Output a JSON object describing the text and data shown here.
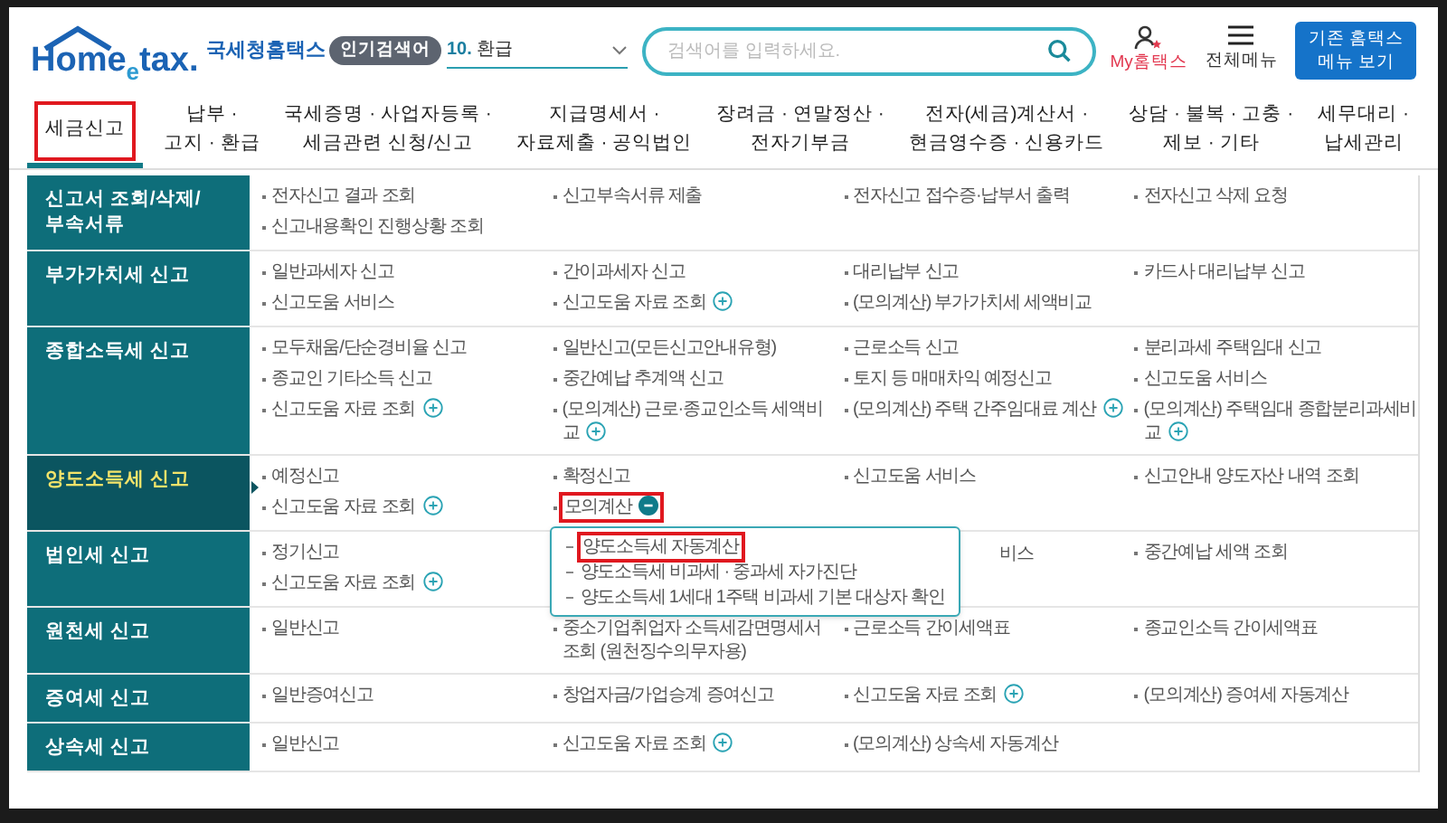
{
  "header": {
    "logo_text": "Home",
    "logo_e": "e",
    "logo_tax": "tax.",
    "site_name": "국세청홈택스",
    "popular_badge": "인기검색어",
    "popular_rank": "10.",
    "popular_term": "환급",
    "search": {
      "placeholder": "검색어를 입력하세요."
    },
    "my_link": "My홈택스",
    "menu_label": "전체메뉴",
    "legacy_button": "기존 홈택스\n메뉴 보기"
  },
  "nav": [
    {
      "label": "세금신고",
      "selected": true,
      "highlighted": true
    },
    {
      "label": "납부 ·\n고지 · 환급",
      "selected": false,
      "highlighted": false
    },
    {
      "label": "국세증명 · 사업자등록 ·\n세금관련 신청/신고",
      "selected": false,
      "highlighted": false
    },
    {
      "label": "지급명세서 ·\n자료제출 · 공익법인",
      "selected": false,
      "highlighted": false
    },
    {
      "label": "장려금 · 연말정산 ·\n전자기부금",
      "selected": false,
      "highlighted": false
    },
    {
      "label": "전자(세금)계산서 ·\n현금영수증 · 신용카드",
      "selected": false,
      "highlighted": false
    },
    {
      "label": "상담 · 불복 · 고충 ·\n제보 · 기타",
      "selected": false,
      "highlighted": false
    },
    {
      "label": "세무대리 ·\n납세관리",
      "selected": false,
      "highlighted": false
    }
  ],
  "sections": [
    {
      "title": "신고서 조회/삭제/\n부속서류",
      "selected": false,
      "columns": [
        [
          {
            "text": "전자신고 결과 조회"
          },
          {
            "text": "신고내용확인 진행상황 조회"
          }
        ],
        [
          {
            "text": "신고부속서류 제출"
          }
        ],
        [
          {
            "text": "전자신고 접수증·납부서 출력"
          }
        ],
        [
          {
            "text": "전자신고 삭제 요청"
          }
        ]
      ]
    },
    {
      "title": "부가가치세 신고",
      "selected": false,
      "columns": [
        [
          {
            "text": "일반과세자 신고"
          },
          {
            "text": "신고도움 서비스"
          }
        ],
        [
          {
            "text": "간이과세자 신고"
          },
          {
            "text": "신고도움 자료 조회",
            "expandable": true,
            "expanded": false
          }
        ],
        [
          {
            "text": "대리납부 신고"
          },
          {
            "text": "(모의계산) 부가가치세 세액비교"
          }
        ],
        [
          {
            "text": "카드사 대리납부 신고"
          }
        ]
      ]
    },
    {
      "title": "종합소득세 신고",
      "selected": false,
      "columns": [
        [
          {
            "text": "모두채움/단순경비율 신고"
          },
          {
            "text": "종교인 기타소득 신고"
          },
          {
            "text": "신고도움 자료 조회",
            "expandable": true,
            "expanded": false
          }
        ],
        [
          {
            "text": "일반신고(모든신고안내유형)"
          },
          {
            "text": "중간예납 추계액 신고"
          },
          {
            "text": "(모의계산) 근로·종교인소득 세액비교",
            "expandable": true,
            "expanded": false
          }
        ],
        [
          {
            "text": "근로소득 신고"
          },
          {
            "text": "토지 등 매매차익 예정신고"
          },
          {
            "text": "(모의계산) 주택 간주임대료 계산",
            "expandable": true,
            "expanded": false
          }
        ],
        [
          {
            "text": "분리과세 주택임대 신고"
          },
          {
            "text": "신고도움 서비스"
          },
          {
            "text": "(모의계산) 주택임대 종합분리과세비교",
            "expandable": true,
            "expanded": false
          }
        ]
      ]
    },
    {
      "title": "양도소득세 신고",
      "selected": true,
      "columns": [
        [
          {
            "text": "예정신고"
          },
          {
            "text": "신고도움 자료 조회",
            "expandable": true,
            "expanded": false
          }
        ],
        [
          {
            "text": "확정신고"
          },
          {
            "text": "모의계산",
            "expandable": true,
            "expanded": true,
            "highlighted": true,
            "submenu": [
              {
                "text": "양도소득세 자동계산",
                "highlighted": true
              },
              {
                "text": "양도소득세 비과세 · 중과세 자가진단",
                "highlighted": false
              },
              {
                "text": "양도소득세 1세대 1주택 비과세 기본 대상자 확인",
                "highlighted": false
              }
            ]
          }
        ],
        [
          {
            "text": "신고도움 서비스"
          }
        ],
        [
          {
            "text": "신고안내 양도자산 내역 조회"
          }
        ]
      ]
    },
    {
      "title": "법인세 신고",
      "selected": false,
      "columns": [
        [
          {
            "text": "정기신고"
          },
          {
            "text": "신고도움 자료 조회",
            "expandable": true,
            "expanded": false
          }
        ],
        [],
        [
          {
            "text": "비스",
            "clipped": true
          }
        ],
        [
          {
            "text": "중간예납 세액 조회"
          }
        ]
      ]
    },
    {
      "title": "원천세 신고",
      "selected": false,
      "columns": [
        [
          {
            "text": "일반신고"
          }
        ],
        [
          {
            "text": "중소기업취업자 소득세감면명세서 조회 (원천징수의무자용)"
          }
        ],
        [
          {
            "text": "근로소득 간이세액표"
          }
        ],
        [
          {
            "text": "종교인소득 간이세액표"
          }
        ]
      ]
    },
    {
      "title": "증여세 신고",
      "selected": false,
      "columns": [
        [
          {
            "text": "일반증여신고"
          }
        ],
        [
          {
            "text": "창업자금/가업승계 증여신고"
          }
        ],
        [
          {
            "text": "신고도움 자료 조회",
            "expandable": true,
            "expanded": false
          }
        ],
        [
          {
            "text": "(모의계산) 증여세 자동계산"
          }
        ]
      ]
    },
    {
      "title": "상속세 신고",
      "selected": false,
      "columns": [
        [
          {
            "text": "일반신고"
          }
        ],
        [
          {
            "text": "신고도움 자료 조회",
            "expandable": true,
            "expanded": false
          }
        ],
        [
          {
            "text": "(모의계산) 상속세 자동계산"
          }
        ],
        []
      ]
    }
  ]
}
